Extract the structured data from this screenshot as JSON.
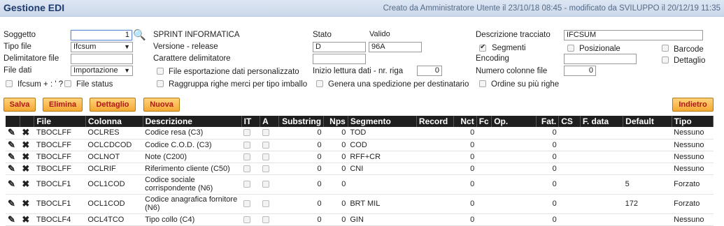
{
  "header": {
    "title": "Gestione EDI",
    "meta": "Creato da Amministratore Utente il 23/10/18 08:45 - modificato da SVILUPPO il 20/12/19 11:35"
  },
  "form": {
    "soggetto_label": "Soggetto",
    "soggetto_value": "1",
    "soggetto_name": "SPRINT INFORMATICA",
    "stato_label": "Stato",
    "stato_value": "Valido",
    "descrizione_tracciato_label": "Descrizione tracciato",
    "descrizione_tracciato_value": "IFCSUM",
    "tipo_file_label": "Tipo file",
    "tipo_file_value": "Ifcsum",
    "versione_label": "Versione - release",
    "versione_value": "D",
    "release_value": "96A",
    "segmenti_label": "Segmenti",
    "posizionale_label": "Posizionale",
    "barcode_label": "Barcode",
    "delimitatore_label": "Delimitatore file",
    "carattere_label": "Carattere delimitatore",
    "encoding_label": "Encoding",
    "dettaglio_label": "Dettaglio",
    "file_dati_label": "File dati",
    "file_dati_value": "Importazione",
    "esportazione_label": "File esportazione dati personalizzato",
    "inizio_lettura_label": "Inizio lettura dati - nr. riga",
    "inizio_lettura_value": "0",
    "numero_colonne_label": "Numero colonne file",
    "numero_colonne_value": "0",
    "ifcsum_label": "Ifcsum + : ' ?",
    "file_status_label": "File status",
    "raggruppa_label": "Raggruppa righe merci per tipo imballo",
    "genera_label": "Genera una spedizione per destinatario",
    "ordine_label": "Ordine su più righe"
  },
  "buttons": {
    "salva": "Salva",
    "elimina": "Elimina",
    "dettaglio": "Dettaglio",
    "nuova": "Nuova",
    "indietro": "Indietro"
  },
  "table": {
    "headers": [
      "File",
      "Colonna",
      "Descrizione",
      "IT",
      "A",
      "Substring",
      "Nps",
      "Segmento",
      "Record",
      "Nct",
      "Fc",
      "Op.",
      "Fat.",
      "CS",
      "F. data",
      "Default",
      "Tipo"
    ],
    "rows": [
      {
        "file": "TBOCLFF",
        "colonna": "OCLRES",
        "descrizione": "Codice resa (C3)",
        "substring": "0",
        "nps": "0",
        "segmento": "TOD",
        "record": "",
        "nct": "0",
        "fat": "0",
        "default": "",
        "tipo": "Nessuno"
      },
      {
        "file": "TBOCLFF",
        "colonna": "OCLCDCOD",
        "descrizione": "Codice C.O.D. (C3)",
        "substring": "0",
        "nps": "0",
        "segmento": "COD",
        "record": "",
        "nct": "0",
        "fat": "0",
        "default": "",
        "tipo": "Nessuno"
      },
      {
        "file": "TBOCLFF",
        "colonna": "OCLNOT",
        "descrizione": "Note (C200)",
        "substring": "0",
        "nps": "0",
        "segmento": "RFF+CR",
        "record": "",
        "nct": "0",
        "fat": "0",
        "default": "",
        "tipo": "Nessuno"
      },
      {
        "file": "TBOCLFF",
        "colonna": "OCLRIF",
        "descrizione": "Riferimento cliente (C50)",
        "substring": "0",
        "nps": "0",
        "segmento": "CNI",
        "record": "",
        "nct": "0",
        "fat": "0",
        "default": "",
        "tipo": "Nessuno"
      },
      {
        "file": "TBOCLF1",
        "colonna": "OCL1COD",
        "descrizione": "Codice sociale corrispondente (N6)",
        "substring": "0",
        "nps": "0",
        "segmento": "",
        "record": "",
        "nct": "0",
        "fat": "0",
        "default": "5",
        "tipo": "Forzato"
      },
      {
        "file": "TBOCLF1",
        "colonna": "OCL1COD",
        "descrizione": "Codice anagrafica fornitore (N6)",
        "substring": "0",
        "nps": "0",
        "segmento": "BRT MIL",
        "record": "",
        "nct": "0",
        "fat": "0",
        "default": "172",
        "tipo": "Forzato"
      },
      {
        "file": "TBOCLF4",
        "colonna": "OCL4TCO",
        "descrizione": "Tipo collo (C4)",
        "substring": "0",
        "nps": "0",
        "segmento": "GIN",
        "record": "",
        "nct": "0",
        "fat": "0",
        "default": "",
        "tipo": "Nessuno"
      }
    ]
  },
  "icons": {
    "edit": "pencil-icon",
    "delete": "x-icon",
    "search": "search-icon"
  }
}
